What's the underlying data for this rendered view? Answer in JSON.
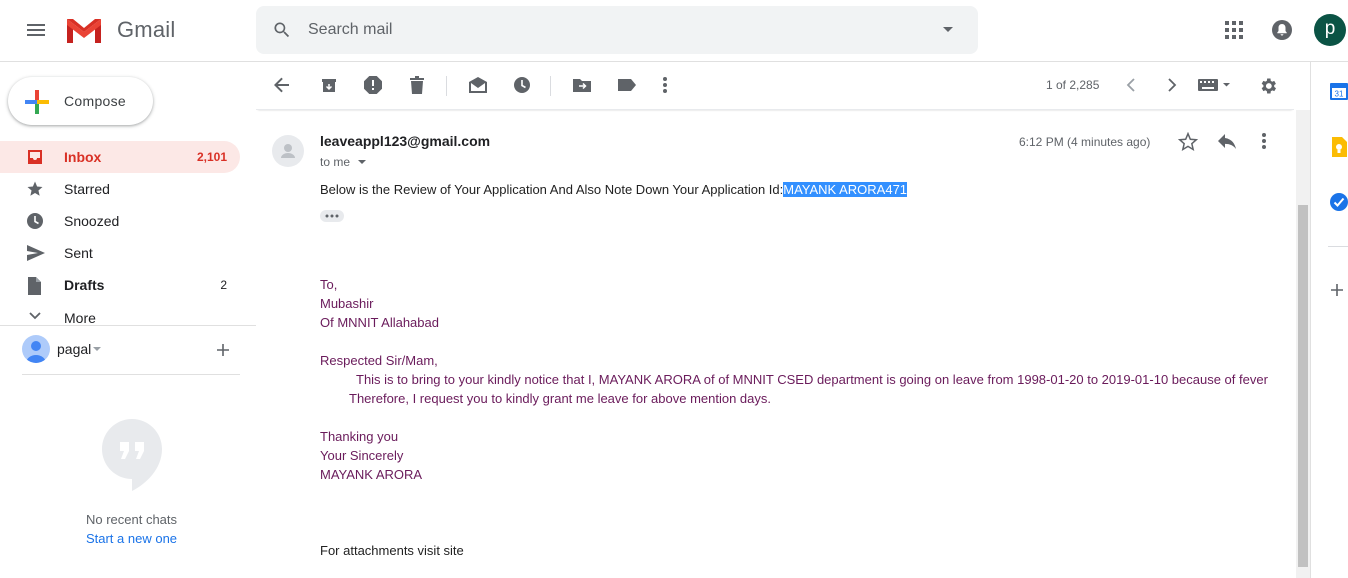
{
  "header": {
    "app_name": "Gmail",
    "search_placeholder": "Search mail",
    "user_initial": "p"
  },
  "sidebar": {
    "compose_label": "Compose",
    "items": [
      {
        "label": "Inbox",
        "count": "2,101",
        "icon": "inbox-icon"
      },
      {
        "label": "Starred",
        "count": "",
        "icon": "star-icon"
      },
      {
        "label": "Snoozed",
        "count": "",
        "icon": "clock-icon"
      },
      {
        "label": "Sent",
        "count": "",
        "icon": "send-icon"
      },
      {
        "label": "Drafts",
        "count": "2",
        "icon": "draft-icon"
      },
      {
        "label": "More",
        "count": "",
        "icon": "chevron-down-icon"
      }
    ]
  },
  "hangouts": {
    "user_name": "pagal",
    "no_chats": "No recent chats",
    "start_new": "Start a new one"
  },
  "toolbar": {
    "page_count": "1 of 2,285"
  },
  "message": {
    "sender": "leaveappl123@gmail.com",
    "to": "to me",
    "time": "6:12 PM (4 minutes ago)",
    "summary_prefix": "Below is the Review of Your Application And Also Note Down Your Application Id:",
    "application_id": "MAYANK ARORA471",
    "body": [
      "To,",
      "Mubashir",
      "Of MNNIT Allahabad",
      "Respected Sir/Mam,",
      "This is to bring to your kindly notice that I, MAYANK ARORA of  of MNNIT CSED department is going on leave  from 1998-01-20 to 2019-01-10 because of fever",
      "Therefore, I request you to kindly grant me leave for above mention days.",
      "Thanking you",
      "Your Sincerely",
      "MAYANK ARORA",
      "For attachments visit site"
    ]
  },
  "right_panel": {
    "calendar_day": "31"
  },
  "colors": {
    "accent_red": "#d93025",
    "inbox_bg": "#fce8e6",
    "body_text": "#6a1b5b",
    "highlight": "#3390ff"
  }
}
